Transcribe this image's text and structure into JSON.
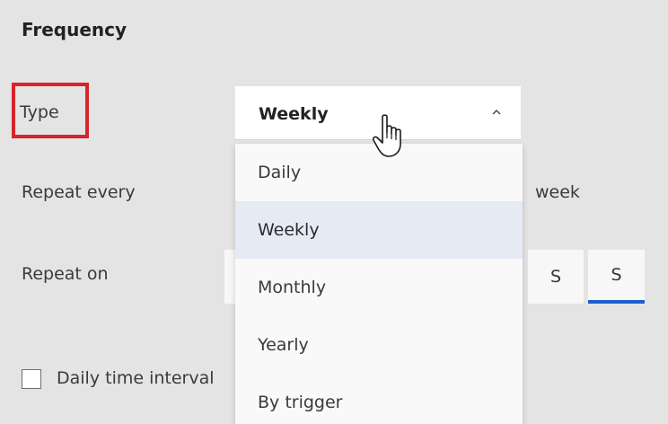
{
  "section": {
    "title": "Frequency"
  },
  "fields": {
    "type_label": "Type",
    "repeat_every_label": "Repeat every",
    "repeat_unit": "week",
    "repeat_on_label": "Repeat on"
  },
  "type_select": {
    "value": "Weekly",
    "expanded": true,
    "chevron_icon": "chevron-up-icon",
    "options": [
      {
        "label": "Daily",
        "selected": false
      },
      {
        "label": "Weekly",
        "selected": true
      },
      {
        "label": "Monthly",
        "selected": false
      },
      {
        "label": "Yearly",
        "selected": false
      },
      {
        "label": "By trigger",
        "selected": false
      }
    ]
  },
  "repeat_on_days": [
    {
      "label": "S",
      "selected": false
    },
    {
      "label": "S",
      "selected": true
    }
  ],
  "daily_time_interval": {
    "label": "Daily time interval",
    "checked": false
  },
  "colors": {
    "highlight": "#d6242a",
    "selected_option_bg": "#e5eaf5",
    "selected_day_underline": "#1f5dcc",
    "panel_bg": "#e4e4e4"
  },
  "cursor_icon": "hand-pointer-icon"
}
